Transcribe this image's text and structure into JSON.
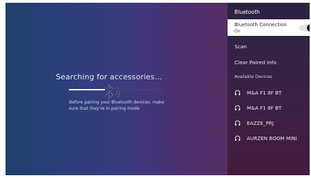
{
  "search": {
    "title": "Searching for accessories...",
    "hint_line1": "Before pairing your Bluetooth devices, make",
    "hint_line2": "sure that they're in pairing mode",
    "progress_fraction": 0.38,
    "watermark_icon": "bluetooth-icon"
  },
  "panel": {
    "header": "Bluetooth",
    "connection": {
      "title": "Bluetooth Connection",
      "status": "On",
      "toggle_on": true
    },
    "menu": [
      {
        "label": "Scan"
      },
      {
        "label": "Clear Paired Info"
      }
    ],
    "available_label": "Available Devices",
    "devices": [
      {
        "name": "M&A F1 8F BT",
        "icon": "headphones-icon"
      },
      {
        "name": "M&A F1 8F BT",
        "icon": "headphones-icon"
      },
      {
        "name": "EAZZE_PRJ",
        "icon": "headphones-icon"
      },
      {
        "name": "AURZEN BOOM MINI",
        "icon": "headphones-icon"
      }
    ]
  },
  "colors": {
    "accent_white": "#ffffff",
    "panel_bg": "#3a2145",
    "left_bg_start": "#1e3f6b",
    "left_bg_end": "#552f63"
  }
}
